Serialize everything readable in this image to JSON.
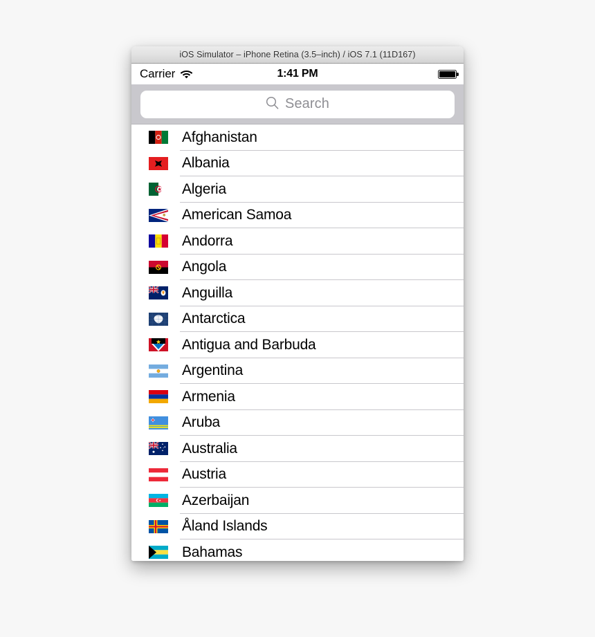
{
  "window": {
    "title": "iOS Simulator – iPhone Retina (3.5–inch) / iOS 7.1 (11D167)"
  },
  "status_bar": {
    "carrier": "Carrier",
    "wifi_icon": "wifi-icon",
    "time": "1:41 PM",
    "battery_icon": "battery-icon",
    "battery_level_percent": 100
  },
  "search": {
    "icon": "search-icon",
    "placeholder": "Search",
    "value": ""
  },
  "colors": {
    "desktop_background": "#f7f7f7",
    "search_bar_background": "#c9c8cd",
    "separator": "#c8c7cc",
    "placeholder_text": "#8e8e93",
    "row_text": "#000000",
    "title_bar_text": "#2f2f2f"
  },
  "list": {
    "rows": [
      {
        "name": "Afghanistan",
        "flag": "flag-afghanistan"
      },
      {
        "name": "Albania",
        "flag": "flag-albania"
      },
      {
        "name": "Algeria",
        "flag": "flag-algeria"
      },
      {
        "name": "American Samoa",
        "flag": "flag-american-samoa"
      },
      {
        "name": "Andorra",
        "flag": "flag-andorra"
      },
      {
        "name": "Angola",
        "flag": "flag-angola"
      },
      {
        "name": "Anguilla",
        "flag": "flag-anguilla"
      },
      {
        "name": "Antarctica",
        "flag": "flag-antarctica"
      },
      {
        "name": "Antigua and Barbuda",
        "flag": "flag-antigua-and-barbuda"
      },
      {
        "name": "Argentina",
        "flag": "flag-argentina"
      },
      {
        "name": "Armenia",
        "flag": "flag-armenia"
      },
      {
        "name": "Aruba",
        "flag": "flag-aruba"
      },
      {
        "name": "Australia",
        "flag": "flag-australia"
      },
      {
        "name": "Austria",
        "flag": "flag-austria"
      },
      {
        "name": "Azerbaijan",
        "flag": "flag-azerbaijan"
      },
      {
        "name": "Åland Islands",
        "flag": "flag-aland-islands"
      },
      {
        "name": "Bahamas",
        "flag": "flag-bahamas"
      }
    ]
  }
}
